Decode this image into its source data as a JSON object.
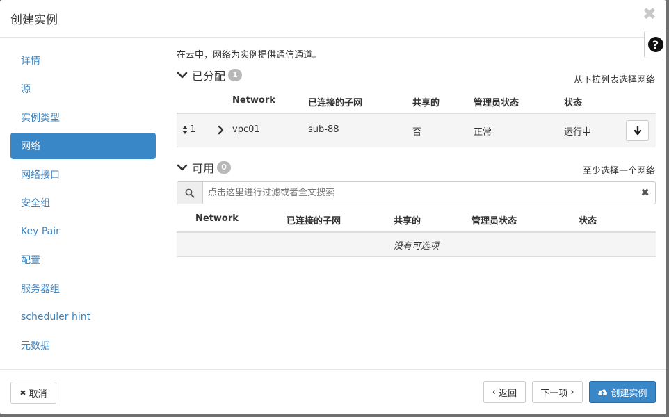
{
  "dialog": {
    "title": "创建实例",
    "close_glyph": "✖",
    "help_glyph": "?"
  },
  "sidebar": {
    "items": [
      {
        "label": "详情"
      },
      {
        "label": "源"
      },
      {
        "label": "实例类型"
      },
      {
        "label": "网络",
        "active": true
      },
      {
        "label": "网络接口"
      },
      {
        "label": "安全组"
      },
      {
        "label": "Key Pair"
      },
      {
        "label": "配置"
      },
      {
        "label": "服务器组"
      },
      {
        "label": "scheduler hint"
      },
      {
        "label": "元数据"
      }
    ]
  },
  "main": {
    "intro": "在云中，网络为实例提供通信通道。",
    "allocated": {
      "title": "已分配",
      "count": "1",
      "hint": "从下拉列表选择网络",
      "columns": [
        "Network",
        "已连接的子网",
        "共享的",
        "管理员状态",
        "状态"
      ],
      "rows": [
        {
          "order": "1",
          "network": "vpc01",
          "subnet": "sub-88",
          "shared": "否",
          "admin_state": "正常",
          "status": "运行中"
        }
      ]
    },
    "available": {
      "title": "可用",
      "count": "0",
      "hint": "至少选择一个网络",
      "search_placeholder": "点击这里进行过滤或者全文搜索",
      "columns": [
        "Network",
        "已连接的子网",
        "共享的",
        "管理员状态",
        "状态"
      ],
      "empty_text": "没有可选项"
    }
  },
  "footer": {
    "cancel": "取消",
    "back": "返回",
    "next": "下一项",
    "create": "创建实例"
  },
  "icons": {
    "close": "close-icon",
    "help": "question-icon",
    "chevron": "chevron-down-icon",
    "sort": "sort-icon",
    "expand": "chevron-right-icon",
    "down_arrow": "arrow-down-icon",
    "search": "search-icon",
    "clear": "clear-icon",
    "cloud": "cloud-upload-icon"
  },
  "colors": {
    "accent": "#3a87c8",
    "link": "#3f83bd",
    "badge": "#b8b8b8"
  }
}
